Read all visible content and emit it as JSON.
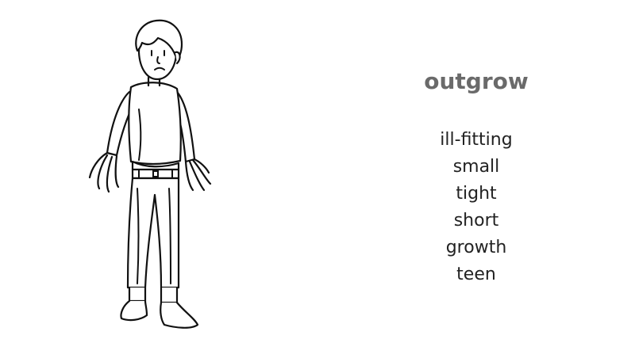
{
  "headword": "outgrow",
  "related_words": [
    "ill-fitting",
    "small",
    "tight",
    "short",
    "growth",
    "teen"
  ],
  "illustration": {
    "icon": "boy-outgrown-clothes-illustration",
    "line_color": "#111111",
    "fill_color": "#ffffff"
  },
  "colors": {
    "headword": "#6a6a6a",
    "words": "#222222",
    "background": "#ffffff"
  }
}
